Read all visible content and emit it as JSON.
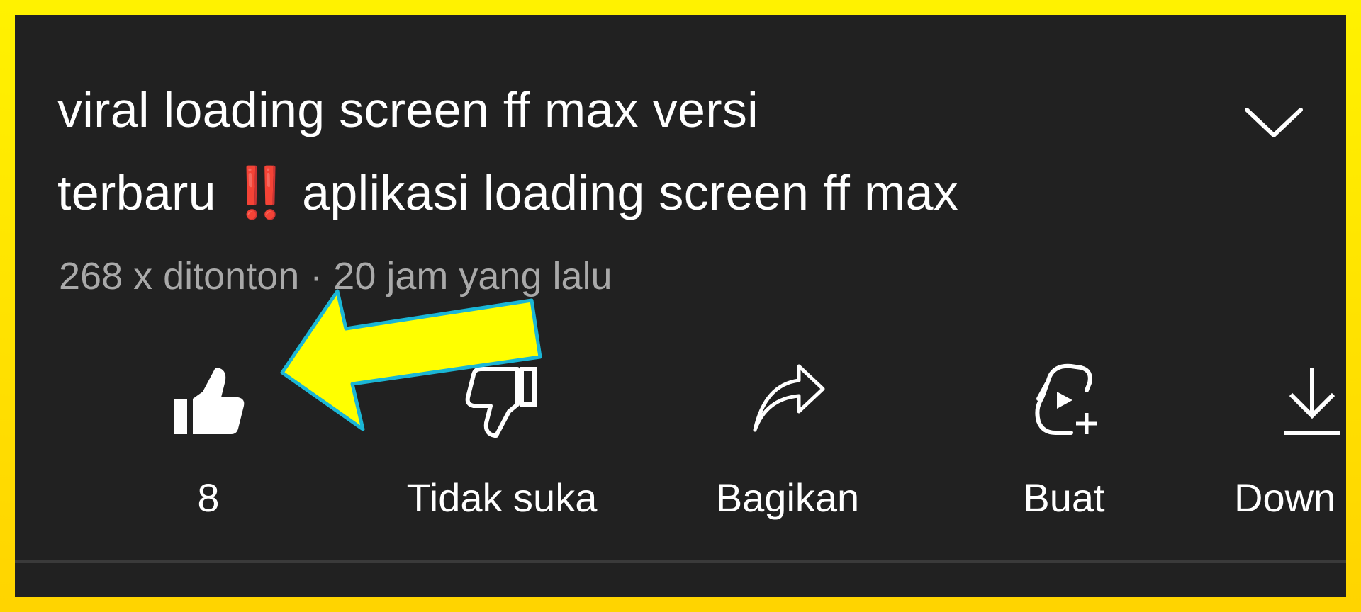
{
  "video": {
    "title_line1": "viral loading screen ff max versi",
    "title_line2_before": "terbaru",
    "title_emoji": "‼️",
    "title_line2_after": "aplikasi loading screen ff max",
    "views": "268 x ditonton",
    "separator": "·",
    "age": "20 jam yang lalu"
  },
  "actions": {
    "like_count": "8",
    "dislike_label": "Tidak suka",
    "share_label": "Bagikan",
    "create_label": "Buat",
    "download_label": "Down"
  },
  "icons": {
    "expand": "chevron-down-icon",
    "like": "thumbs-up-icon",
    "dislike": "thumbs-down-icon",
    "share": "share-arrow-icon",
    "create": "create-clip-icon",
    "download": "download-icon",
    "annotation": "yellow-arrow"
  },
  "colors": {
    "frame": "#ffe600",
    "panel": "#212121",
    "text": "#ffffff",
    "meta_text": "#a9a9a9",
    "emoji": "#e2231a",
    "arrow_fill": "#ffff00",
    "arrow_stroke": "#1ab6d6"
  }
}
